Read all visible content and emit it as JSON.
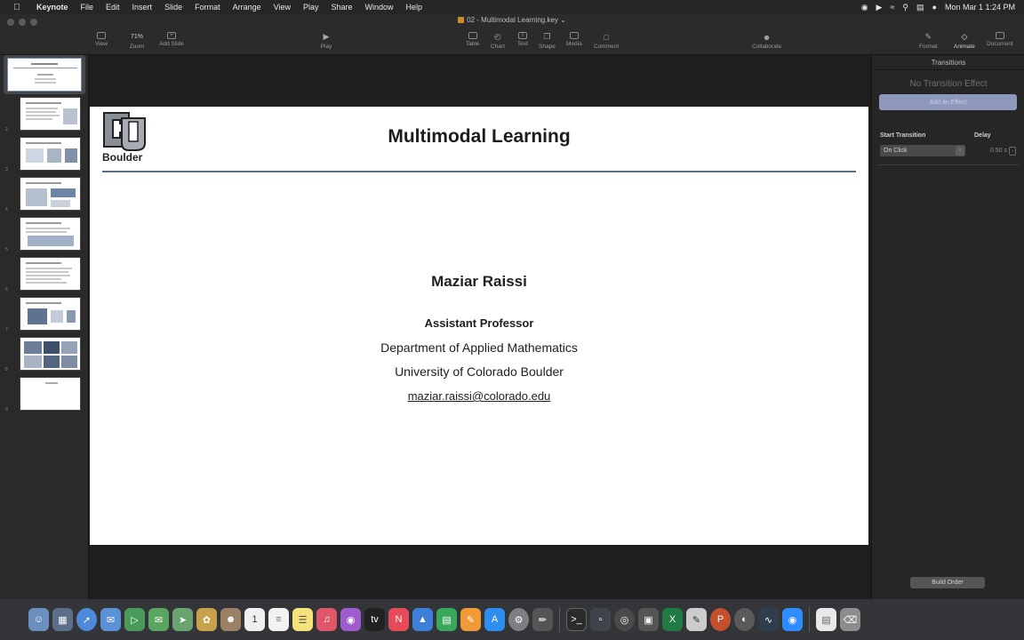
{
  "menubar": {
    "app": "Keynote",
    "menus": [
      "File",
      "Edit",
      "Insert",
      "Slide",
      "Format",
      "Arrange",
      "View",
      "Play",
      "Share",
      "Window",
      "Help"
    ],
    "datetime": "Mon Mar 1  1:24 PM"
  },
  "window": {
    "title": "02 - Multimodal Learning.key"
  },
  "toolbar": {
    "view": "View",
    "zoom_value": "71%",
    "zoom": "Zoom",
    "add_slide": "Add Slide",
    "play": "Play",
    "table": "Table",
    "chart": "Chart",
    "text": "Text",
    "shape": "Shape",
    "media": "Media",
    "comment": "Comment",
    "collaborate": "Collaborate",
    "format": "Format",
    "animate": "Animate",
    "document": "Document"
  },
  "navigator": {
    "slide_numbers": [
      "1",
      "2",
      "3",
      "4",
      "5",
      "6",
      "7",
      "8",
      "9"
    ],
    "selected": 1
  },
  "slide": {
    "logo_text": "Boulder",
    "title": "Multimodal Learning",
    "author": "Maziar Raissi",
    "position": "Assistant Professor",
    "department": "Department of Applied Mathematics",
    "university": "University of Colorado Boulder",
    "email": "maziar.raissi@colorado.edu"
  },
  "inspector": {
    "tab": "Transitions",
    "no_effect": "No Transition Effect",
    "add_effect": "Add an Effect",
    "start_label": "Start Transition",
    "delay_label": "Delay",
    "start_value": "On Click",
    "delay_value": "0.50 s",
    "build_order": "Build Order"
  },
  "colors": {
    "accent": "#8e98bc",
    "title_rule": "#5d6e86",
    "logo": "#8a8f96"
  },
  "dock": [
    "finder",
    "launchpad",
    "safari",
    "mail",
    "facetime",
    "messages",
    "maps",
    "photos",
    "contacts",
    "calendar",
    "reminders",
    "notes",
    "music",
    "podcasts",
    "tv",
    "news",
    "keynote",
    "numbers",
    "pages",
    "app-store",
    "system-preferences",
    "terminal",
    "activity-monitor",
    "screenshot",
    "excel",
    "script-editor",
    "powerpoint",
    "disk-utility",
    "zoom",
    "document",
    "trash"
  ]
}
